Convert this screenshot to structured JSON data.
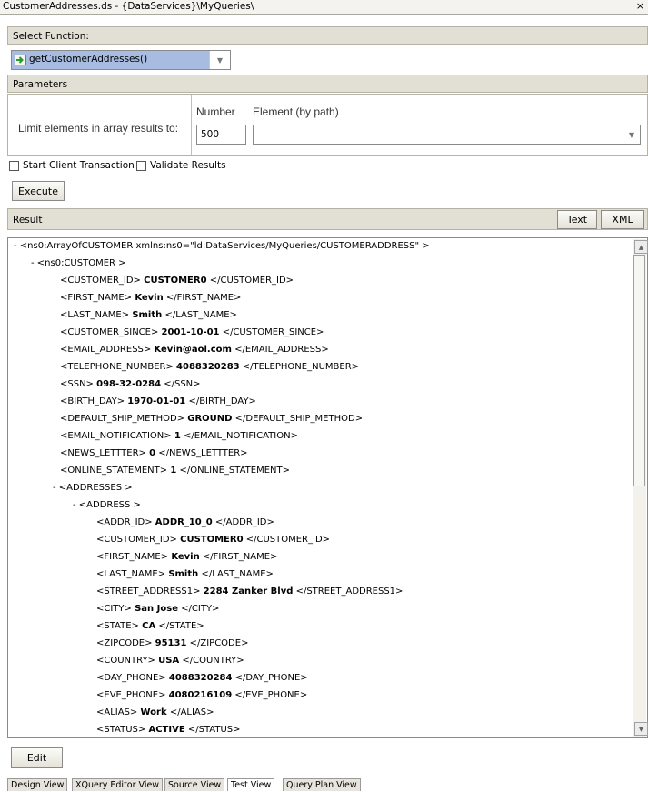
{
  "window": {
    "title": "CustomerAddresses.ds - {DataServices}\\MyQueries\\",
    "close_glyph": "×"
  },
  "select_function": {
    "header": "Select Function:",
    "selected": "getCustomerAddresses()",
    "icon": "green-arrow-function-icon"
  },
  "parameters": {
    "header": "Parameters",
    "limit_label": "Limit elements in array results to:",
    "number_header": "Number",
    "element_header": "Element (by path)",
    "number_value": "500",
    "element_value": ""
  },
  "options": {
    "start_client_transaction": {
      "label": "Start Client Transaction",
      "checked": false
    },
    "validate_results": {
      "label": "Validate Results",
      "checked": false
    }
  },
  "execute_label": "Execute",
  "result": {
    "header": "Result",
    "text_button": "Text",
    "xml_button": "XML"
  },
  "xml_lines": [
    {
      "indent": 0,
      "pre": "- <ns0:ArrayOfCUSTOMER xmlns:ns0=\"ld:DataServices/MyQueries/CUSTOMERADDRESS\" >",
      "val": "",
      "post": ""
    },
    {
      "indent": 1,
      "pre": "- <ns0:CUSTOMER >",
      "val": "",
      "post": ""
    },
    {
      "indent": 2,
      "pre": "<CUSTOMER_ID> ",
      "val": "CUSTOMER0",
      "post": " </CUSTOMER_ID>"
    },
    {
      "indent": 2,
      "pre": "<FIRST_NAME> ",
      "val": "Kevin",
      "post": " </FIRST_NAME>"
    },
    {
      "indent": 2,
      "pre": "<LAST_NAME> ",
      "val": "Smith",
      "post": " </LAST_NAME>"
    },
    {
      "indent": 2,
      "pre": "<CUSTOMER_SINCE> ",
      "val": "2001-10-01",
      "post": " </CUSTOMER_SINCE>"
    },
    {
      "indent": 2,
      "pre": "<EMAIL_ADDRESS> ",
      "val": "Kevin@aol.com",
      "post": " </EMAIL_ADDRESS>"
    },
    {
      "indent": 2,
      "pre": "<TELEPHONE_NUMBER> ",
      "val": "4088320283",
      "post": " </TELEPHONE_NUMBER>"
    },
    {
      "indent": 2,
      "pre": "<SSN> ",
      "val": "098-32-0284",
      "post": " </SSN>"
    },
    {
      "indent": 2,
      "pre": "<BIRTH_DAY> ",
      "val": "1970-01-01",
      "post": " </BIRTH_DAY>"
    },
    {
      "indent": 2,
      "pre": "<DEFAULT_SHIP_METHOD> ",
      "val": "GROUND",
      "post": " </DEFAULT_SHIP_METHOD>"
    },
    {
      "indent": 2,
      "pre": "<EMAIL_NOTIFICATION> ",
      "val": "1",
      "post": " </EMAIL_NOTIFICATION>"
    },
    {
      "indent": 2,
      "pre": "<NEWS_LETTTER> ",
      "val": "0",
      "post": " </NEWS_LETTTER>"
    },
    {
      "indent": 2,
      "pre": "<ONLINE_STATEMENT> ",
      "val": "1",
      "post": " </ONLINE_STATEMENT>"
    },
    {
      "indent": 3,
      "pre": "- <ADDRESSES >",
      "val": "",
      "post": ""
    },
    {
      "indent": 4,
      "pre": "- <ADDRESS >",
      "val": "",
      "post": ""
    },
    {
      "indent": 5,
      "pre": "<ADDR_ID> ",
      "val": "ADDR_10_0",
      "post": " </ADDR_ID>"
    },
    {
      "indent": 5,
      "pre": "<CUSTOMER_ID> ",
      "val": "CUSTOMER0",
      "post": " </CUSTOMER_ID>"
    },
    {
      "indent": 5,
      "pre": "<FIRST_NAME> ",
      "val": "Kevin",
      "post": " </FIRST_NAME>"
    },
    {
      "indent": 5,
      "pre": "<LAST_NAME> ",
      "val": "Smith",
      "post": " </LAST_NAME>"
    },
    {
      "indent": 5,
      "pre": "<STREET_ADDRESS1> ",
      "val": "2284 Zanker Blvd",
      "post": " </STREET_ADDRESS1>"
    },
    {
      "indent": 5,
      "pre": "<CITY> ",
      "val": "San Jose",
      "post": " </CITY>"
    },
    {
      "indent": 5,
      "pre": "<STATE> ",
      "val": "CA",
      "post": " </STATE>"
    },
    {
      "indent": 5,
      "pre": "<ZIPCODE> ",
      "val": "95131",
      "post": " </ZIPCODE>"
    },
    {
      "indent": 5,
      "pre": "<COUNTRY> ",
      "val": "USA",
      "post": " </COUNTRY>"
    },
    {
      "indent": 5,
      "pre": "<DAY_PHONE> ",
      "val": "4088320284",
      "post": " </DAY_PHONE>"
    },
    {
      "indent": 5,
      "pre": "<EVE_PHONE> ",
      "val": "4080216109",
      "post": " </EVE_PHONE>"
    },
    {
      "indent": 5,
      "pre": "<ALIAS> ",
      "val": "Work",
      "post": " </ALIAS>"
    },
    {
      "indent": 5,
      "pre": "<STATUS> ",
      "val": "ACTIVE",
      "post": " </STATUS>"
    }
  ],
  "edit_label": "Edit",
  "view_tabs": [
    "Design View",
    "XQuery Editor View",
    "Source View",
    "Test View",
    "Query Plan View"
  ],
  "active_tab": "Test View",
  "colors": {
    "panel": "#e2dfd4",
    "selected": "#a7bce0",
    "border": "#b6b2a6"
  }
}
